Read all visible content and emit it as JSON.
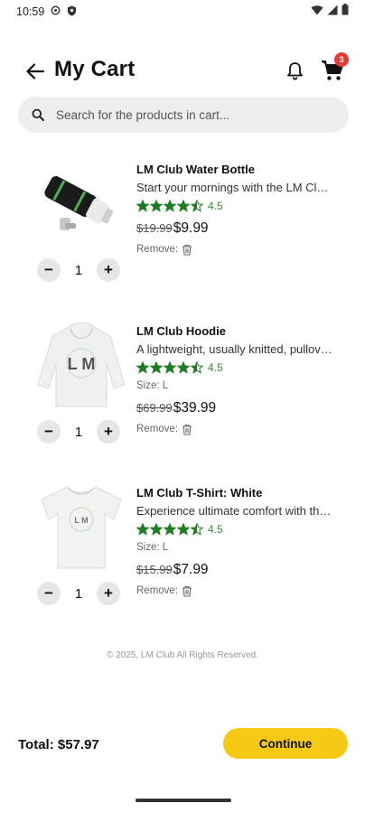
{
  "status_bar": {
    "time": "10:59",
    "icons": [
      "settings-icon",
      "shield-icon",
      "wifi-icon",
      "signal-icon",
      "battery-icon"
    ]
  },
  "header": {
    "title": "My Cart",
    "cart_badge_count": "3",
    "icons": [
      "back-arrow-icon",
      "bell-icon",
      "cart-icon"
    ]
  },
  "search": {
    "placeholder": "Search for the products in cart...",
    "value": ""
  },
  "items": [
    {
      "name": "LM Club Water Bottle",
      "description": "Start your mornings with the LM Club Water Bottle",
      "rating": "4.5",
      "stars": 4.5,
      "size_label": "",
      "old_price": "$19.99",
      "new_price": "$9.99",
      "remove_label": "Remove:",
      "quantity": "1",
      "image_icon": "water-bottle-image"
    },
    {
      "name": "LM Club Hoodie",
      "description": "A lightweight, usually knitted, pullover hoodie",
      "rating": "4.5",
      "stars": 4.5,
      "size_label": "Size: L",
      "old_price": "$69.99",
      "new_price": "$39.99",
      "remove_label": "Remove:",
      "quantity": "1",
      "image_icon": "hoodie-image"
    },
    {
      "name": "LM Club T-Shirt: White",
      "description": "Experience ultimate comfort with the LM Club T-Shirt",
      "rating": "4.5",
      "stars": 4.5,
      "size_label": "Size: L",
      "old_price": "$15.99",
      "new_price": "$7.99",
      "remove_label": "Remove:",
      "quantity": "1",
      "image_icon": "tshirt-image"
    }
  ],
  "quantity_controls": {
    "minus": "−",
    "plus": "+"
  },
  "footer": {
    "copyright": "© 2025, LM Club All Rights Reserved."
  },
  "bottom_bar": {
    "total": "Total: $57.97",
    "continue_label": "Continue"
  },
  "colors": {
    "accent_yellow": "#f6c914",
    "star_green": "#1e7d22",
    "badge_red": "#e53935",
    "search_bg": "#eeeeee"
  }
}
